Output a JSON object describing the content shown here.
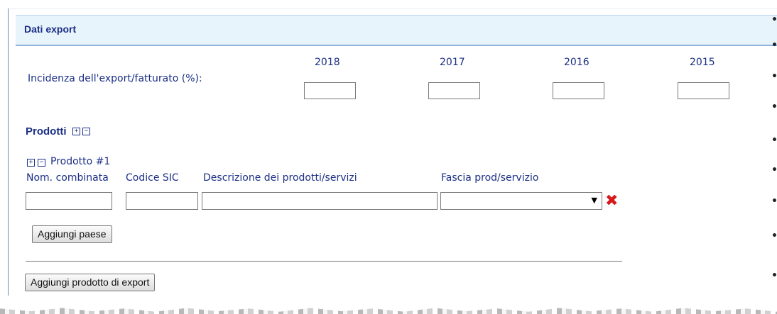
{
  "section": {
    "title": "Dati export"
  },
  "export_share": {
    "label": "Incidenza dell'export/fatturato (%):",
    "years": [
      "2018",
      "2017",
      "2016",
      "2015"
    ],
    "values": [
      "",
      "",
      "",
      ""
    ]
  },
  "products": {
    "title": "Prodotti",
    "expand_symbol": "+",
    "collapse_symbol": "−",
    "item": {
      "title": "Prodotto #1",
      "labels": {
        "nom_combinata": "Nom. combinata",
        "codice_sic": "Codice SIC",
        "descrizione": "Descrizione dei prodotti/servizi",
        "fascia": "Fascia prod/servizio"
      },
      "values": {
        "nom_combinata": "",
        "codice_sic": "",
        "descrizione": "",
        "fascia": ""
      },
      "dropdown_arrow": "▼",
      "delete_symbol": "✖",
      "add_country_button": "Aggiungi paese"
    },
    "add_product_button": "Aggiungi prodotto di export"
  }
}
